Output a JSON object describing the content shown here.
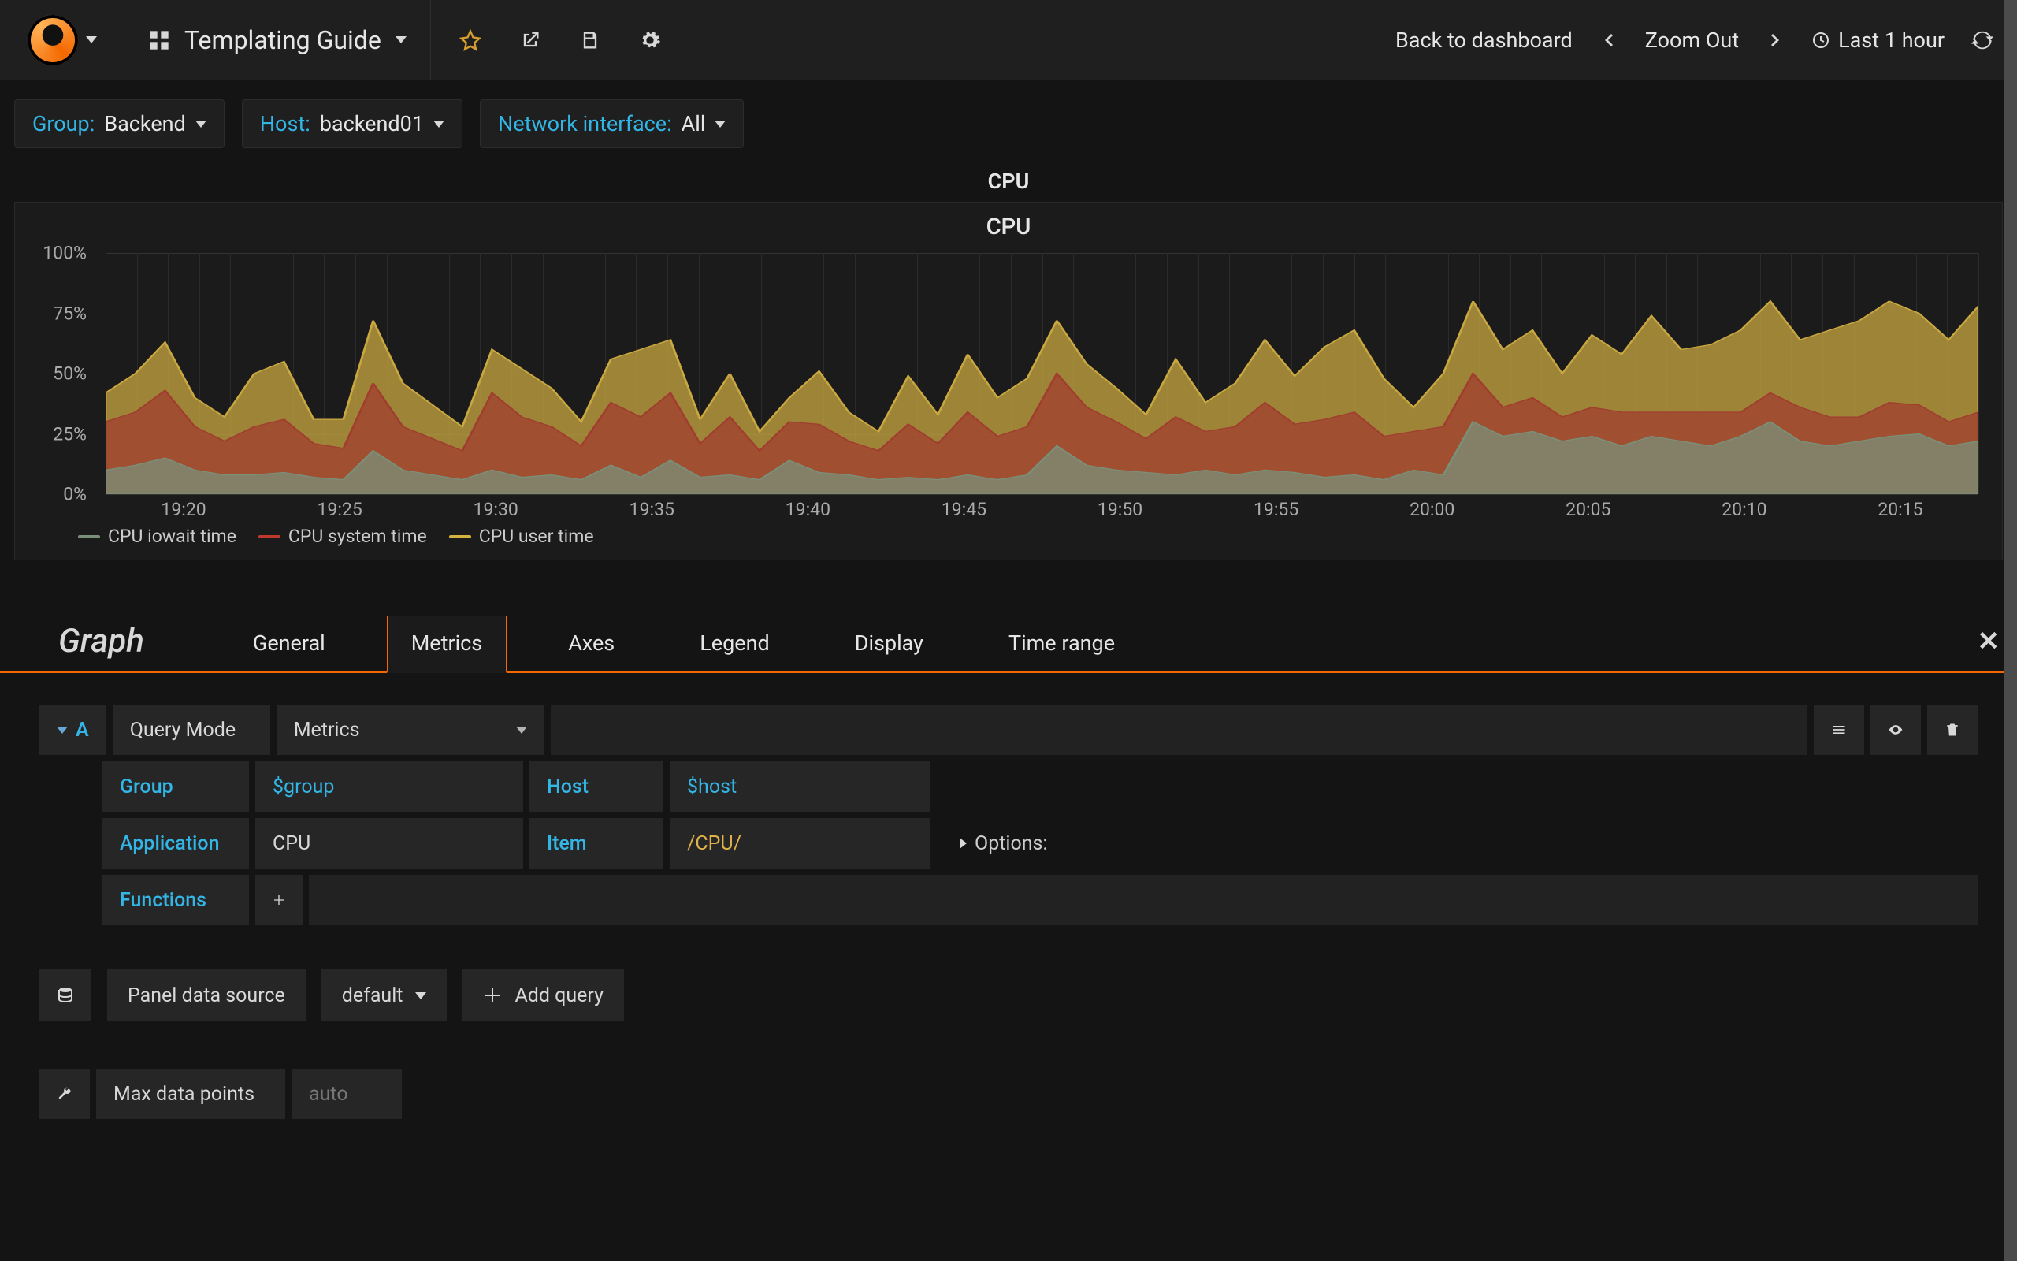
{
  "header": {
    "dashboard_title": "Templating Guide",
    "back_link": "Back to dashboard",
    "zoom_out": "Zoom Out",
    "time_range": "Last 1 hour"
  },
  "template_vars": [
    {
      "label": "Group:",
      "value": "Backend"
    },
    {
      "label": "Host:",
      "value": "backend01"
    },
    {
      "label": "Network interface:",
      "value": "All"
    }
  ],
  "row_title": "CPU",
  "panel": {
    "title": "CPU"
  },
  "chart_data": {
    "type": "area",
    "stacked": true,
    "title": "CPU",
    "ylabel": "",
    "ylim": [
      0,
      100
    ],
    "y_unit": "%",
    "y_ticks": [
      0,
      25,
      50,
      75,
      100
    ],
    "x_ticks": [
      "19:20",
      "19:25",
      "19:30",
      "19:35",
      "19:40",
      "19:45",
      "19:50",
      "19:55",
      "20:00",
      "20:05",
      "20:10",
      "20:15"
    ],
    "series": [
      {
        "name": "CPU iowait time",
        "color": "#7a9079",
        "values": [
          10,
          12,
          15,
          10,
          8,
          8,
          9,
          7,
          6,
          18,
          10,
          8,
          6,
          10,
          7,
          8,
          6,
          12,
          7,
          14,
          7,
          8,
          6,
          14,
          9,
          8,
          6,
          7,
          6,
          8,
          6,
          8,
          20,
          12,
          10,
          9,
          8,
          10,
          8,
          10,
          9,
          7,
          8,
          6,
          10,
          8,
          30,
          24,
          26,
          22,
          24,
          20,
          24,
          22,
          20,
          24,
          30,
          22,
          20,
          22,
          24,
          25,
          20,
          22
        ]
      },
      {
        "name": "CPU system time",
        "color": "#a13d2f",
        "values": [
          20,
          22,
          28,
          18,
          14,
          20,
          22,
          14,
          13,
          28,
          18,
          15,
          12,
          32,
          25,
          20,
          14,
          26,
          25,
          28,
          14,
          24,
          12,
          16,
          20,
          14,
          12,
          22,
          15,
          26,
          18,
          20,
          30,
          24,
          20,
          14,
          24,
          16,
          20,
          28,
          20,
          24,
          26,
          18,
          16,
          20,
          20,
          12,
          14,
          10,
          12,
          14,
          10,
          12,
          14,
          10,
          12,
          14,
          12,
          10,
          14,
          12,
          10,
          12
        ]
      },
      {
        "name": "CPU user time",
        "color": "#c9a841",
        "values": [
          12,
          16,
          20,
          12,
          10,
          22,
          24,
          10,
          12,
          26,
          18,
          14,
          10,
          18,
          20,
          16,
          10,
          18,
          28,
          22,
          10,
          18,
          8,
          10,
          22,
          12,
          8,
          20,
          12,
          24,
          16,
          20,
          22,
          18,
          14,
          10,
          24,
          12,
          18,
          26,
          20,
          30,
          34,
          24,
          10,
          22,
          30,
          24,
          28,
          18,
          30,
          24,
          40,
          26,
          28,
          34,
          38,
          28,
          36,
          40,
          42,
          38,
          34,
          44
        ]
      }
    ],
    "legend": [
      "CPU iowait time",
      "CPU system time",
      "CPU user time"
    ]
  },
  "editor": {
    "panel_type": "Graph",
    "tabs": [
      "General",
      "Metrics",
      "Axes",
      "Legend",
      "Display",
      "Time range"
    ],
    "active_tab": "Metrics",
    "query_letter": "A",
    "query_mode_label": "Query Mode",
    "query_mode_value": "Metrics",
    "fields": {
      "group_label": "Group",
      "group_value": "$group",
      "host_label": "Host",
      "host_value": "$host",
      "application_label": "Application",
      "application_value": "CPU",
      "item_label": "Item",
      "item_value": "/CPU/",
      "options_label": "Options:",
      "functions_label": "Functions"
    },
    "datasource": {
      "panel_ds_label": "Panel data source",
      "panel_ds_value": "default",
      "add_query": "Add query"
    },
    "max_data_points_label": "Max data points",
    "max_data_points_placeholder": "auto"
  }
}
